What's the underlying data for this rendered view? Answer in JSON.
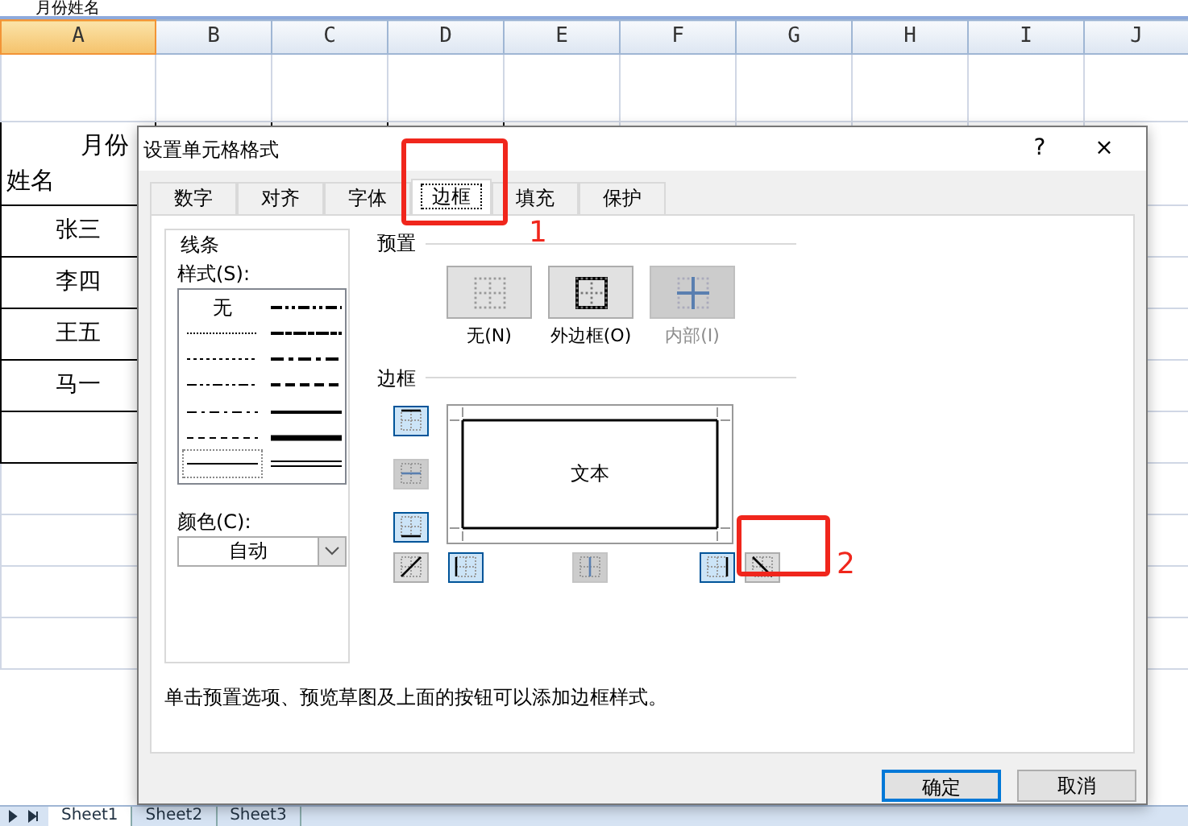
{
  "formula_bar": {
    "text": "月份姓名"
  },
  "sheet": {
    "columns": [
      {
        "label": "A",
        "selected": true
      },
      {
        "label": "B",
        "selected": false
      },
      {
        "label": "C",
        "selected": false
      },
      {
        "label": "D",
        "selected": false
      },
      {
        "label": "E",
        "selected": false
      },
      {
        "label": "F",
        "selected": false
      },
      {
        "label": "G",
        "selected": false
      },
      {
        "label": "H",
        "selected": false
      },
      {
        "label": "I",
        "selected": false
      },
      {
        "label": "J",
        "selected": false
      }
    ],
    "header_cell": {
      "top": "月份",
      "bottom": "姓名"
    },
    "names": [
      "张三",
      "李四",
      "王五",
      "马一"
    ]
  },
  "sheet_tabs": [
    {
      "label": "Sheet1",
      "selected": true
    },
    {
      "label": "Sheet2",
      "selected": false
    },
    {
      "label": "Sheet3",
      "selected": false
    }
  ],
  "dialog": {
    "title": "设置单元格格式",
    "help": "?",
    "close": "×",
    "tabs": [
      {
        "label": "数字",
        "selected": false
      },
      {
        "label": "对齐",
        "selected": false
      },
      {
        "label": "字体",
        "selected": false
      },
      {
        "label": "边框",
        "selected": true
      },
      {
        "label": "填充",
        "selected": false
      },
      {
        "label": "保护",
        "selected": false
      }
    ],
    "line_group": "线条",
    "style_label": "样式(S):",
    "line_styles": [
      {
        "kind": "none",
        "text": "无",
        "selected": false
      },
      {
        "kind": "mdashdotdot",
        "selected": false
      },
      {
        "kind": "hair",
        "selected": false
      },
      {
        "kind": "slant",
        "selected": false
      },
      {
        "kind": "dotted",
        "selected": false
      },
      {
        "kind": "mdashdot",
        "selected": false
      },
      {
        "kind": "dashdotdot",
        "selected": false
      },
      {
        "kind": "mdashed",
        "selected": false
      },
      {
        "kind": "dashdot",
        "selected": false
      },
      {
        "kind": "medium",
        "selected": false
      },
      {
        "kind": "dashed",
        "selected": false
      },
      {
        "kind": "thick",
        "selected": false
      },
      {
        "kind": "thin",
        "selected": true
      },
      {
        "kind": "double",
        "selected": false
      }
    ],
    "color_label": "颜色(C):",
    "color_value": "自动",
    "presets_label": "预置",
    "presets": [
      {
        "kind": "none",
        "label": "无(N)",
        "disabled": false
      },
      {
        "kind": "outline",
        "label": "外边框(O)",
        "disabled": false
      },
      {
        "kind": "inside",
        "label": "内部(I)",
        "disabled": true
      }
    ],
    "border_label": "边框",
    "border_buttons": [
      {
        "kind": "top",
        "on": true,
        "disabled": false
      },
      {
        "kind": "middle-h",
        "on": false,
        "disabled": true
      },
      {
        "kind": "bottom",
        "on": true,
        "disabled": false
      },
      {
        "kind": "diag-up",
        "on": false,
        "disabled": false
      },
      {
        "kind": "left",
        "on": true,
        "disabled": false
      },
      {
        "kind": "middle-v",
        "on": false,
        "disabled": true
      },
      {
        "kind": "right",
        "on": true,
        "disabled": false
      },
      {
        "kind": "diag-down",
        "on": false,
        "disabled": false
      }
    ],
    "preview_text": "文本",
    "hint": "单击预置选项、预览草图及上面的按钮可以添加边框样式。",
    "buttons": [
      {
        "label": "确定",
        "default": true
      },
      {
        "label": "取消",
        "default": false
      }
    ]
  },
  "annotations": [
    {
      "label": "1"
    },
    {
      "label": "2"
    }
  ]
}
